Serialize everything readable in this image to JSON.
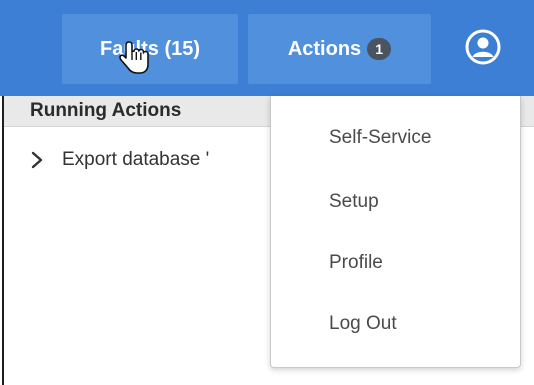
{
  "header": {
    "faults_label": "Faults (15)",
    "actions_label": "Actions",
    "actions_count": "1",
    "user_icon": "user-circle-icon"
  },
  "panel": {
    "section_title": "Running Actions",
    "rows": [
      {
        "label": "Export database '"
      }
    ]
  },
  "user_menu": {
    "items": [
      "Self-Service",
      "Setup",
      "Profile",
      "Log Out"
    ]
  },
  "colors": {
    "header_bg": "#3d7fd4",
    "nav_button_bg": "#5090dd",
    "badge_bg": "#4a5360"
  }
}
